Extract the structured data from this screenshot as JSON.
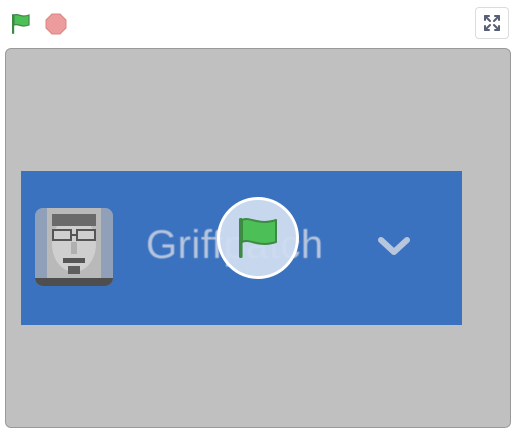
{
  "controls": {
    "green_flag_icon": "green-flag",
    "stop_icon": "stop-sign",
    "fullscreen_icon": "fullscreen-expand"
  },
  "stage": {
    "banner": {
      "username": "Griffpatch",
      "dropdown_icon": "chevron-down"
    },
    "overlay": {
      "icon": "green-flag"
    }
  },
  "colors": {
    "flag_green": "#4cbf56",
    "stop_red": "#ec9c9c",
    "stage_bg": "#c0c0c0",
    "banner_blue": "#3a72c0"
  }
}
